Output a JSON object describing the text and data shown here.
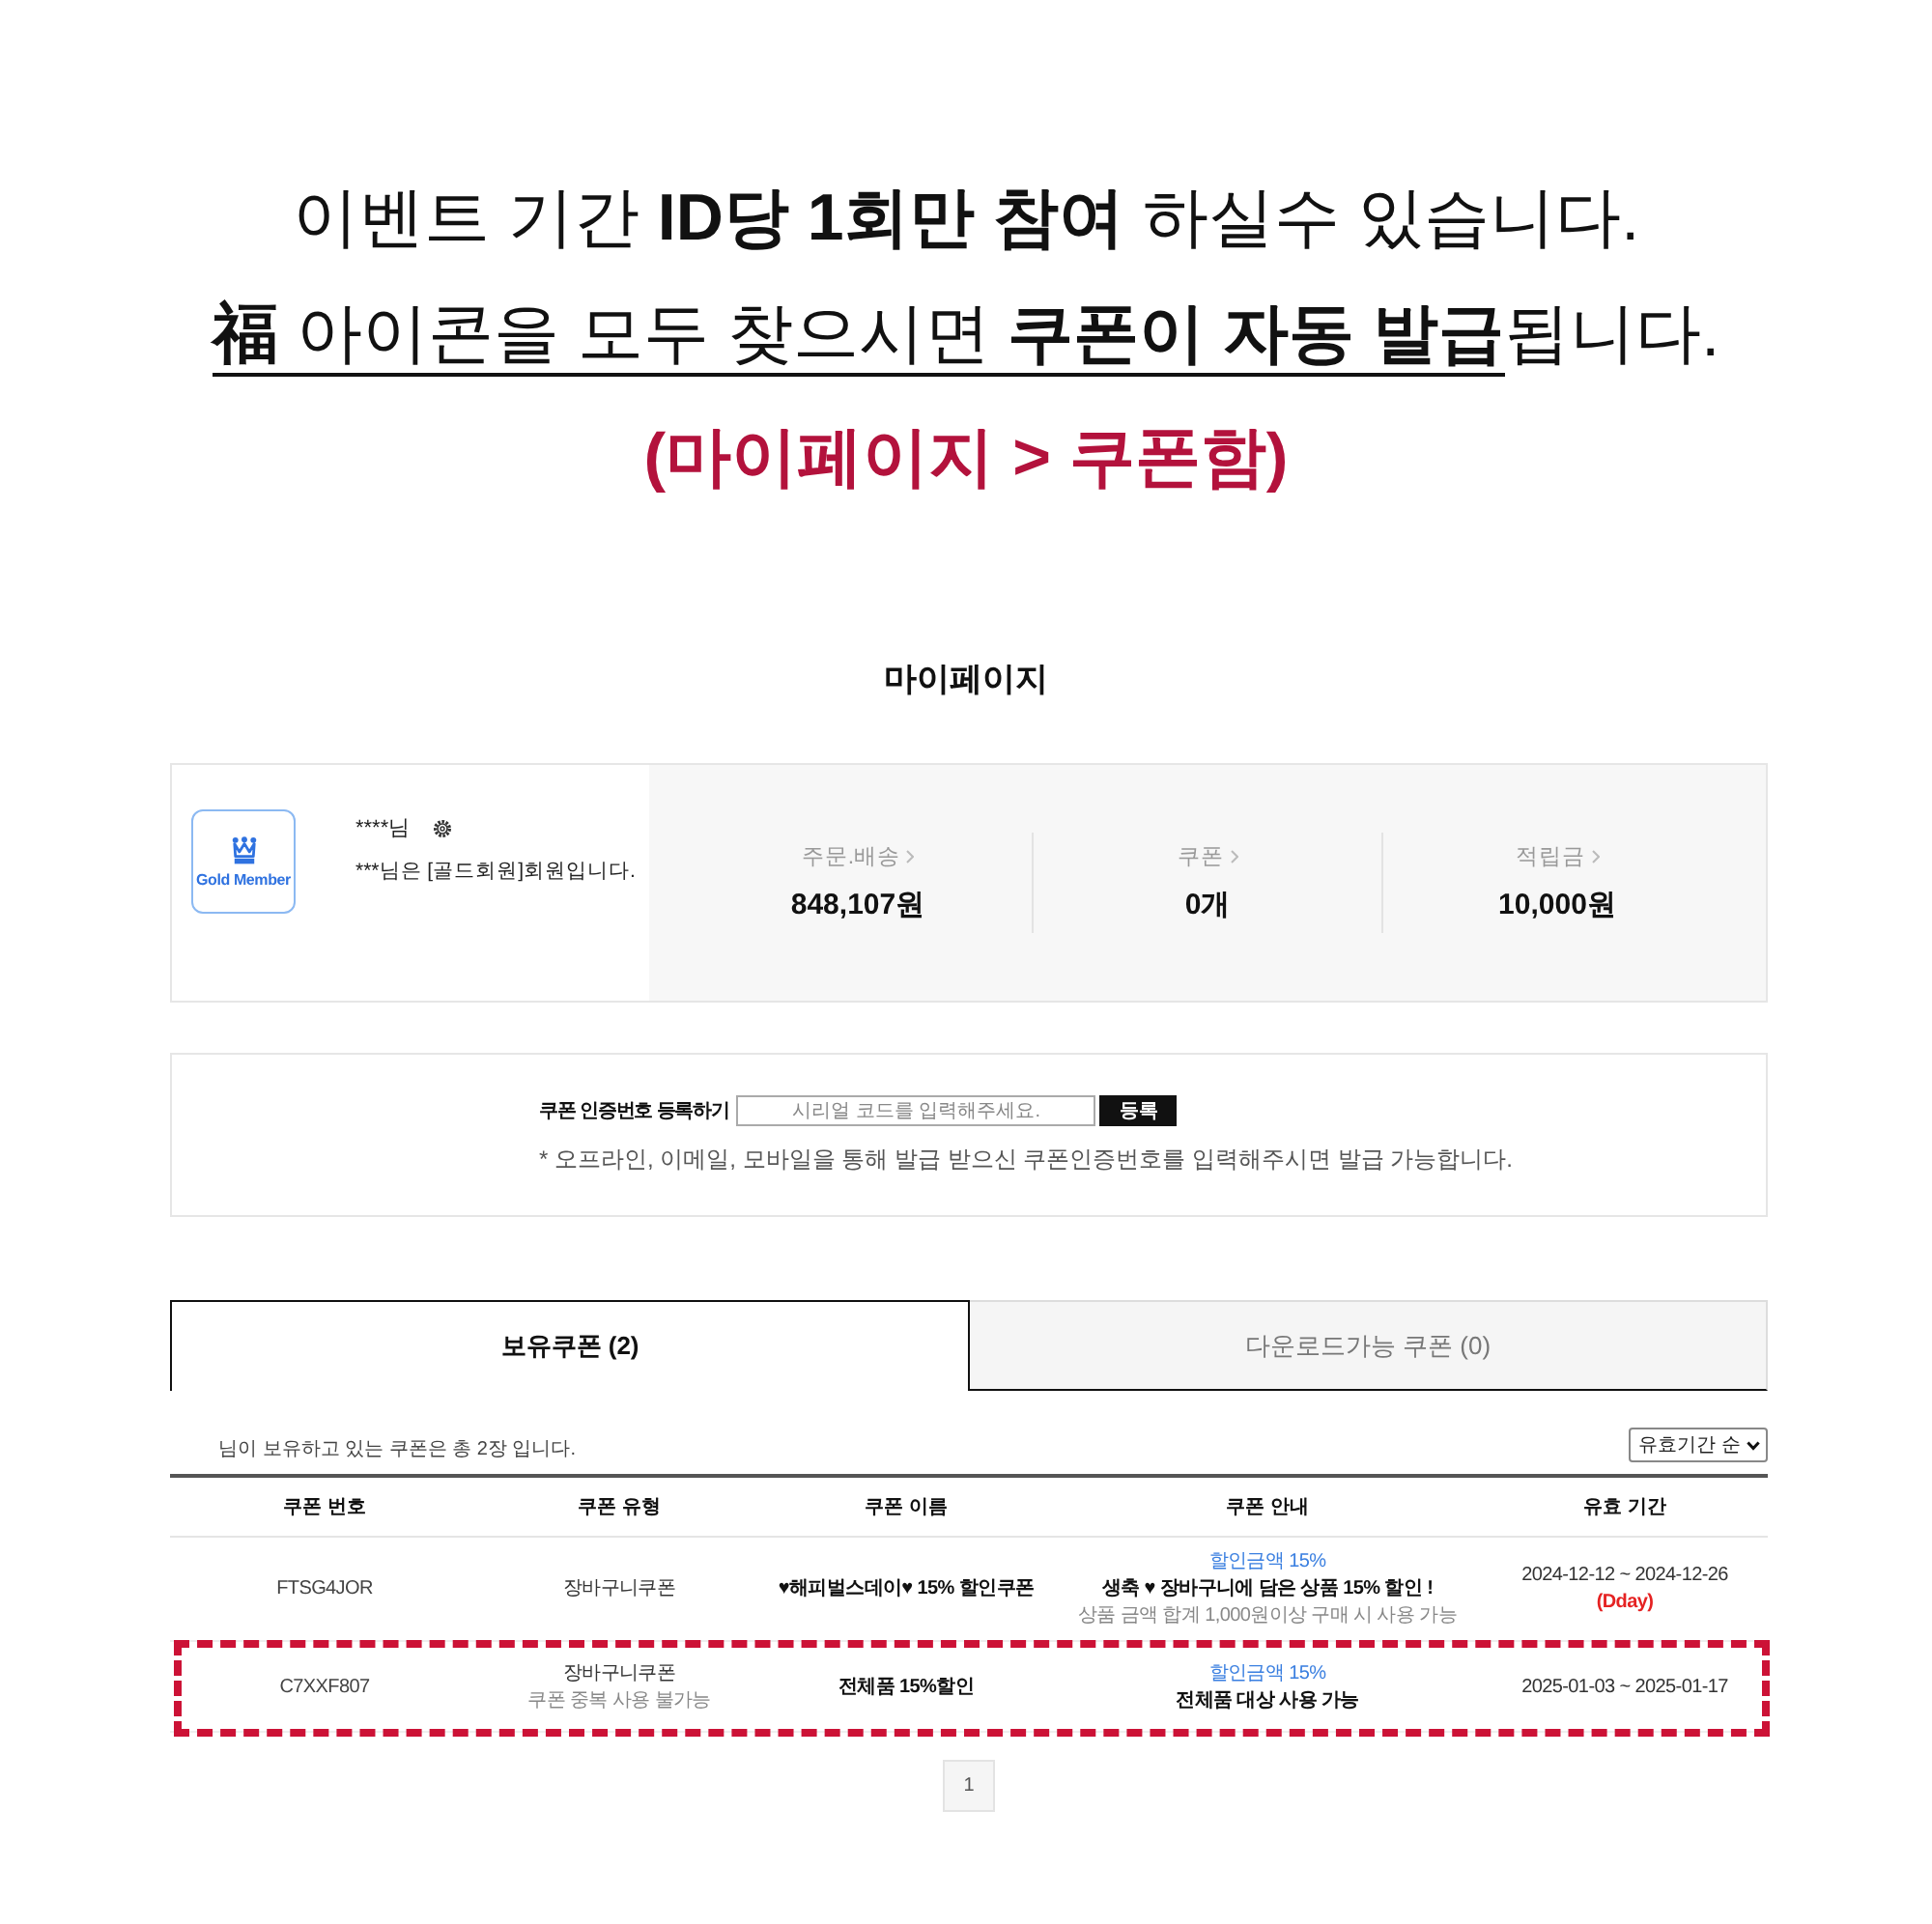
{
  "notice": {
    "line_1": "이벤트 기간 **ID당 1회만 참여** 하실수 있습니다.",
    "line_2": [
      {
        "text": "**福** 아이콘을 모두 찾으시면 **쿠폰이 자동 발급**",
        "underline": true
      },
      {
        "text": "됩니다.",
        "underline": false
      }
    ],
    "line_3": "(마이페이지 > 쿠폰함)"
  },
  "page_title": "마이페이지",
  "profile": {
    "badge": "Gold Member",
    "name": "****님",
    "grade_text": "***님은 [골드회원]회원입니다.",
    "stats": [
      {
        "label": "주문.배송",
        "value": "848,107원"
      },
      {
        "label": "쿠폰",
        "value": "0개"
      },
      {
        "label": "적립금",
        "value": "10,000원"
      }
    ]
  },
  "coupon_register": {
    "label": "쿠폰 인증번호 등록하기",
    "placeholder": "시리얼 코드를 입력해주세요.",
    "button": "등록",
    "note": "* 오프라인, 이메일, 모바일을 통해 발급 받으신 쿠폰인증번호를 입력해주시면 발급 가능합니다."
  },
  "tabs": [
    {
      "label": "보유쿠폰 (2)",
      "selected": true
    },
    {
      "label": "다운로드가능 쿠폰 (0)",
      "selected": false
    }
  ],
  "summary": "님이 보유하고 있는 쿠폰은 총 2장 입니다.",
  "sort_select": "유효기간 순",
  "table": {
    "columns": [
      "쿠폰 번호",
      "쿠폰 유형",
      "쿠폰 이름",
      "쿠폰 안내",
      "유효 기간"
    ],
    "rows": [
      {
        "number": "FTSG4JOR",
        "type": "장바구니쿠폰",
        "name": "♥해피벌스데이♥ 15% 할인쿠폰",
        "discount": "할인금액 15%",
        "description": "생축 ♥ 장바구니에 담은 상품 15% 할인 !",
        "condition": "상품 금액 합계 1,000원이상 구매 시 사용 가능",
        "period": "2024-12-12 ~ 2024-12-26",
        "dday": "(Dday)",
        "highlighted": false
      },
      {
        "number": "C7XXF807",
        "type": "장바구니쿠폰",
        "type_note": "쿠폰 중복 사용 불가능",
        "name": "전체품 15%할인",
        "discount": "할인금액 15%",
        "description": "전체품 대상 사용 가능",
        "period": "2025-01-03 ~ 2025-01-17",
        "highlighted": true
      }
    ]
  },
  "pagination": [
    "1"
  ]
}
